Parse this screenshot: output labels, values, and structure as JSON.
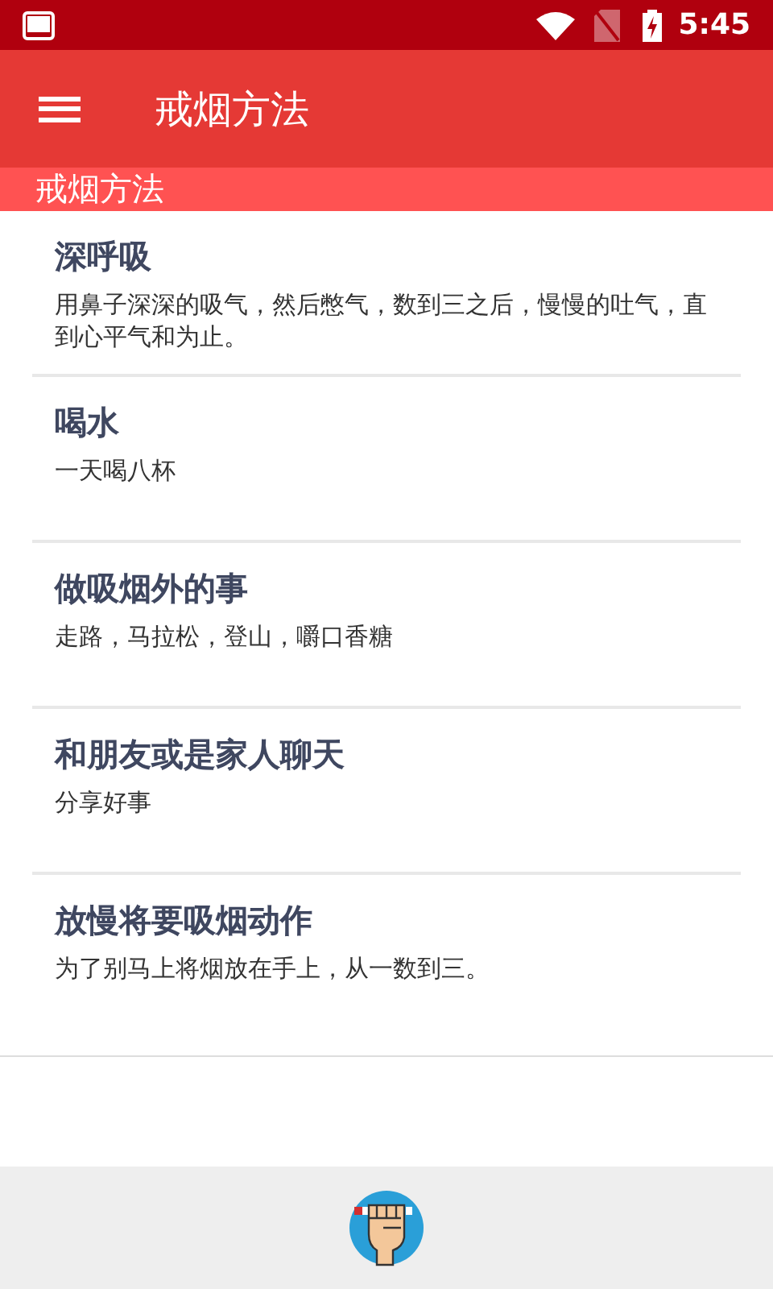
{
  "status_bar": {
    "time": "5:45"
  },
  "toolbar": {
    "title": "戒烟方法"
  },
  "section_header": {
    "title": "戒烟方法"
  },
  "methods": [
    {
      "title": "深呼吸",
      "description": "用鼻子深深的吸气，然后憋气，数到三之后，慢慢的吐气，直到心平气和为止。"
    },
    {
      "title": "喝水",
      "description": "一天喝八杯"
    },
    {
      "title": "做吸烟外的事",
      "description": "走路，马拉松，登山，嚼口香糖"
    },
    {
      "title": "和朋友或是家人聊天",
      "description": "分享好事"
    },
    {
      "title": "放慢将要吸烟动作",
      "description": "为了别马上将烟放在手上，从一数到三。"
    }
  ]
}
